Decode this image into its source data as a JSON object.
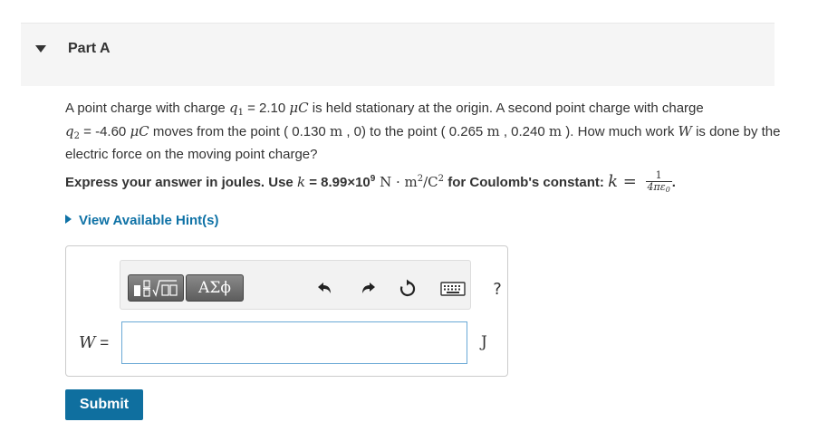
{
  "part": {
    "title": "Part A"
  },
  "problem": {
    "t1": "A point charge with charge ",
    "q1_sym": "q",
    "q1_sub": "1",
    "t2": " = 2.10 ",
    "unit_mu_c1": "μC",
    "t3": " is held stationary at the origin. A second point charge with charge",
    "q2_sym": "q",
    "q2_sub": "2",
    "t4": " = -4.60 ",
    "unit_mu_c2": "μC",
    "t5": " moves from the point ( 0.130 ",
    "m1": "m",
    "t6": " , 0) to the point ( 0.265 ",
    "m2": "m",
    "t7": " , 0.240 ",
    "m3": "m",
    "t8": " ). How much work ",
    "w_sym": "W",
    "t9": " is done by the electric force on the moving point charge?"
  },
  "instruction": {
    "t1": "Express your answer in joules. Use ",
    "k_sym": "k",
    "t2": " = 8.99×10",
    "exp9": "9",
    "unit_n": " N · m",
    "exp2a": "2",
    "unit_c": "/C",
    "exp2b": "2",
    "t3": " for Coulomb's constant: ",
    "k_sym2": "k",
    "eq": " = ",
    "frac_num": "1",
    "frac_den": "4πε",
    "frac_den_sub": "0",
    "period": "."
  },
  "hints": {
    "label": "View Available Hint(s)"
  },
  "toolbar": {
    "symbols_label": "ΑΣϕ",
    "help_label": "?"
  },
  "answer": {
    "variable": "W",
    "equals": " =",
    "value": "",
    "unit": "J"
  },
  "submit": {
    "label": "Submit"
  }
}
